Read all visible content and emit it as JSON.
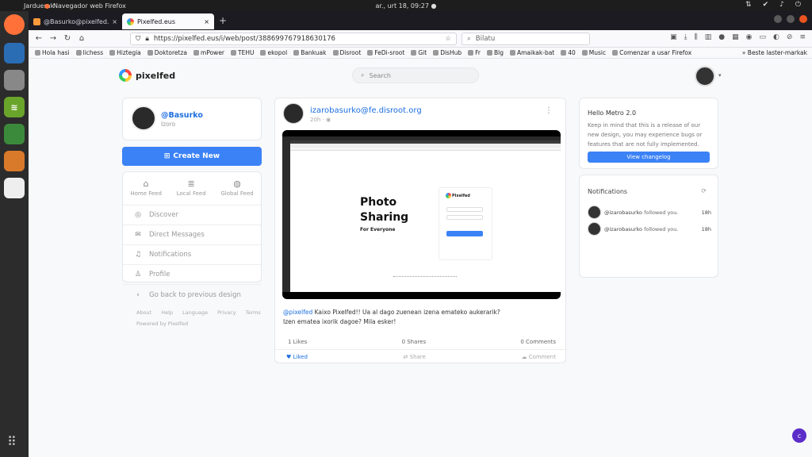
{
  "system": {
    "activities": "Jarduerak",
    "app_name": "Navegador web Firefox",
    "clock": "ar., urt 18, 09:27 ●"
  },
  "browser": {
    "tabs": [
      {
        "title": "@Basurko@pixelfed.eus"
      },
      {
        "title": "Pixelfed.eus"
      }
    ],
    "new_tab": "+",
    "url": "https://pixelfed.eus/i/web/post/388699767918630176",
    "search_placeholder": "Bilatu",
    "bookmarks": [
      "Hola hasi",
      "lichess",
      "Hiztegia",
      "Doktoretza",
      "mPower",
      "TEHU",
      "ekopol",
      "Bankuak",
      "Disroot",
      "FeDi-sroot",
      "Git",
      "DisHub",
      "Fr",
      "Blg",
      "Amaikak-bat",
      "40",
      "Music",
      "Comenzar a usar Firefox"
    ],
    "bookmarks_other": "Beste laster-markak"
  },
  "pixelfed": {
    "logo_text": "pixelfed",
    "search_placeholder": "Search",
    "profile": {
      "username": "@Basurko",
      "subtitle": "Izoro"
    },
    "create_new": "Create New",
    "feed_tabs": [
      {
        "label": "Home Feed",
        "icon": "home-icon"
      },
      {
        "label": "Local Feed",
        "icon": "list-icon"
      },
      {
        "label": "Global Feed",
        "icon": "globe-icon"
      }
    ],
    "nav": [
      {
        "label": "Discover",
        "icon": "compass-icon"
      },
      {
        "label": "Direct Messages",
        "icon": "mail-icon"
      },
      {
        "label": "Notifications",
        "icon": "bell-icon"
      },
      {
        "label": "Profile",
        "icon": "user-icon"
      },
      {
        "label": "Go back to previous design",
        "icon": "chevron-left-icon"
      }
    ],
    "footer_links": [
      "About",
      "Help",
      "Language",
      "Privacy",
      "Terms"
    ],
    "powered_by": "Powered by Pixelfed",
    "post": {
      "author": "izarobasurko@fe.disroot.org",
      "meta": "20h · ◉",
      "image_title_line1": "Photo",
      "image_title_line2": "Sharing",
      "image_subtitle": "For Everyone",
      "image_logo": "Pixelfed",
      "caption_tag": "@pixelfed",
      "caption_text": " Kaixo Pixelfed!! Ua al dago zuenean izena emateko aukerarik?",
      "caption_line2": "Izen ematea ixorik dagoe? Mila esker!",
      "likes": "1 Likes",
      "shares": "0 Shares",
      "comments": "0 Comments",
      "like_label": "Liked",
      "share_label": "Share",
      "comment_label": "Comment"
    },
    "metro": {
      "title": "Hello Metro 2.0",
      "body": "Keep in mind that this is a release of our new design, you may experience bugs or features that are not fully implemented.",
      "button": "View changelog"
    },
    "notifications": {
      "title": "Notifications",
      "items": [
        {
          "user": "@izarobasurko",
          "action": " followed you.",
          "time": "18h"
        },
        {
          "user": "@izarobasurko",
          "action": " followed you.",
          "time": "18h"
        }
      ]
    }
  },
  "colors": {
    "accent": "#3b82f6",
    "link": "#1d6fe0",
    "dock": "#2c2c2c",
    "topbar": "#1d1d1d"
  }
}
